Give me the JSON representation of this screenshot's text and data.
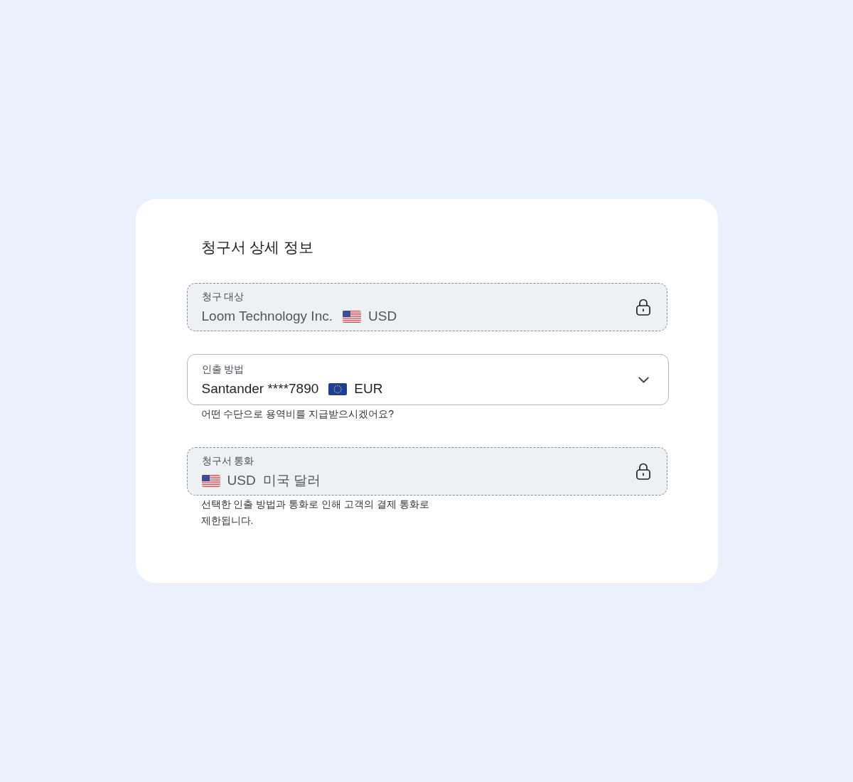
{
  "title": "청구서 상세 정보",
  "fields": [
    {
      "kind": "locked",
      "label": "청구 대상",
      "parts": [
        {
          "kind": "text",
          "text": "Loom Technology Inc."
        },
        {
          "kind": "usflag"
        },
        {
          "kind": "text",
          "text": "USD"
        }
      ]
    },
    {
      "kind": "select",
      "label": "인출 방법",
      "parts": [
        {
          "kind": "text",
          "text": "Santander ****7890"
        },
        {
          "kind": "euflag"
        },
        {
          "kind": "text",
          "text": "EUR"
        }
      ],
      "helper": "어떤 수단으로 용역비를 지급받으시겠어요?"
    },
    {
      "kind": "locked",
      "label": "청구서 통화",
      "parts": [
        {
          "kind": "usflag"
        },
        {
          "kind": "text",
          "text": "USD"
        },
        {
          "kind": "text",
          "text": "미국 달러"
        }
      ],
      "helper": "선택한 인출 방법과 통화로 인해 고객의 결제 통화로 제한됩니다."
    }
  ]
}
